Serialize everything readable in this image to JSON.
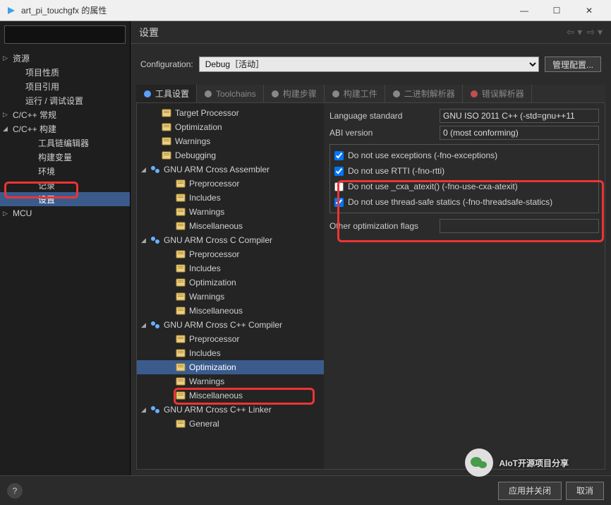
{
  "window": {
    "title": "art_pi_touchgfx 的属性"
  },
  "nav": {
    "items": [
      {
        "label": "资源",
        "level": 0,
        "arrow": "▷"
      },
      {
        "label": "项目性质",
        "level": 1
      },
      {
        "label": "项目引用",
        "level": 1
      },
      {
        "label": "运行 / 调试设置",
        "level": 1
      },
      {
        "label": "C/C++ 常规",
        "level": 0,
        "arrow": "▷"
      },
      {
        "label": "C/C++ 构建",
        "level": 0,
        "arrow": "◢"
      },
      {
        "label": "工具链编辑器",
        "level": 2
      },
      {
        "label": "构建变量",
        "level": 2
      },
      {
        "label": "环境",
        "level": 2
      },
      {
        "label": "记录",
        "level": 2
      },
      {
        "label": "设置",
        "level": 2,
        "selected": true
      },
      {
        "label": "MCU",
        "level": 0,
        "arrow": "▷"
      }
    ]
  },
  "main": {
    "header_title": "设置",
    "config_label": "Configuration:",
    "config_value": "Debug［活动］",
    "manage_btn": "管理配置..."
  },
  "tabs": [
    {
      "label": "工具设置",
      "active": true,
      "icon": "gear-icon",
      "color": "#5aa0ff"
    },
    {
      "label": "Toolchains",
      "icon": "wrench-icon",
      "color": "#888"
    },
    {
      "label": "构建步骤",
      "icon": "hammer-icon",
      "color": "#888"
    },
    {
      "label": "构建工件",
      "icon": "trophy-icon",
      "color": "#888"
    },
    {
      "label": "二进制解析器",
      "icon": "binary-icon",
      "color": "#888"
    },
    {
      "label": "错误解析器",
      "icon": "error-icon",
      "color": "#c05050"
    }
  ],
  "tree2": [
    {
      "label": "Target Processor",
      "level": 1,
      "icon": "page"
    },
    {
      "label": "Optimization",
      "level": 1,
      "icon": "page"
    },
    {
      "label": "Warnings",
      "level": 1,
      "icon": "page"
    },
    {
      "label": "Debugging",
      "level": 1,
      "icon": "page"
    },
    {
      "label": "GNU ARM Cross Assembler",
      "level": 0,
      "icon": "tool",
      "arrow": "◢"
    },
    {
      "label": "Preprocessor",
      "level": 2,
      "icon": "page"
    },
    {
      "label": "Includes",
      "level": 2,
      "icon": "page"
    },
    {
      "label": "Warnings",
      "level": 2,
      "icon": "page"
    },
    {
      "label": "Miscellaneous",
      "level": 2,
      "icon": "page"
    },
    {
      "label": "GNU ARM Cross C Compiler",
      "level": 0,
      "icon": "tool",
      "arrow": "◢"
    },
    {
      "label": "Preprocessor",
      "level": 2,
      "icon": "page"
    },
    {
      "label": "Includes",
      "level": 2,
      "icon": "page"
    },
    {
      "label": "Optimization",
      "level": 2,
      "icon": "page"
    },
    {
      "label": "Warnings",
      "level": 2,
      "icon": "page"
    },
    {
      "label": "Miscellaneous",
      "level": 2,
      "icon": "page"
    },
    {
      "label": "GNU ARM Cross C++ Compiler",
      "level": 0,
      "icon": "tool",
      "arrow": "◢"
    },
    {
      "label": "Preprocessor",
      "level": 2,
      "icon": "page"
    },
    {
      "label": "Includes",
      "level": 2,
      "icon": "page"
    },
    {
      "label": "Optimization",
      "level": 2,
      "icon": "page",
      "selected": true
    },
    {
      "label": "Warnings",
      "level": 2,
      "icon": "page"
    },
    {
      "label": "Miscellaneous",
      "level": 2,
      "icon": "page"
    },
    {
      "label": "GNU ARM Cross C++ Linker",
      "level": 0,
      "icon": "tool",
      "arrow": "◢"
    },
    {
      "label": "General",
      "level": 2,
      "icon": "page"
    }
  ],
  "panel": {
    "rows": [
      {
        "label": "Language standard",
        "value": "GNU ISO 2011 C++ (-std=gnu++11"
      },
      {
        "label": "ABI version",
        "value": "0 (most conforming)"
      }
    ],
    "checks": [
      {
        "checked": true,
        "label": "Do not use exceptions (-fno-exceptions)"
      },
      {
        "checked": true,
        "label": "Do not use RTTI (-fno-rtti)"
      },
      {
        "checked": false,
        "label": "Do not use _cxa_atexit() (-fno-use-cxa-atexit)"
      },
      {
        "checked": true,
        "label": "Do not use thread-safe statics (-fno-threadsafe-statics)"
      }
    ],
    "other_label": "Other optimization flags",
    "other_value": ""
  },
  "footer": {
    "apply_close": "应用并关闭",
    "cancel": "取消"
  },
  "watermark": "AIoT开源项目分享"
}
